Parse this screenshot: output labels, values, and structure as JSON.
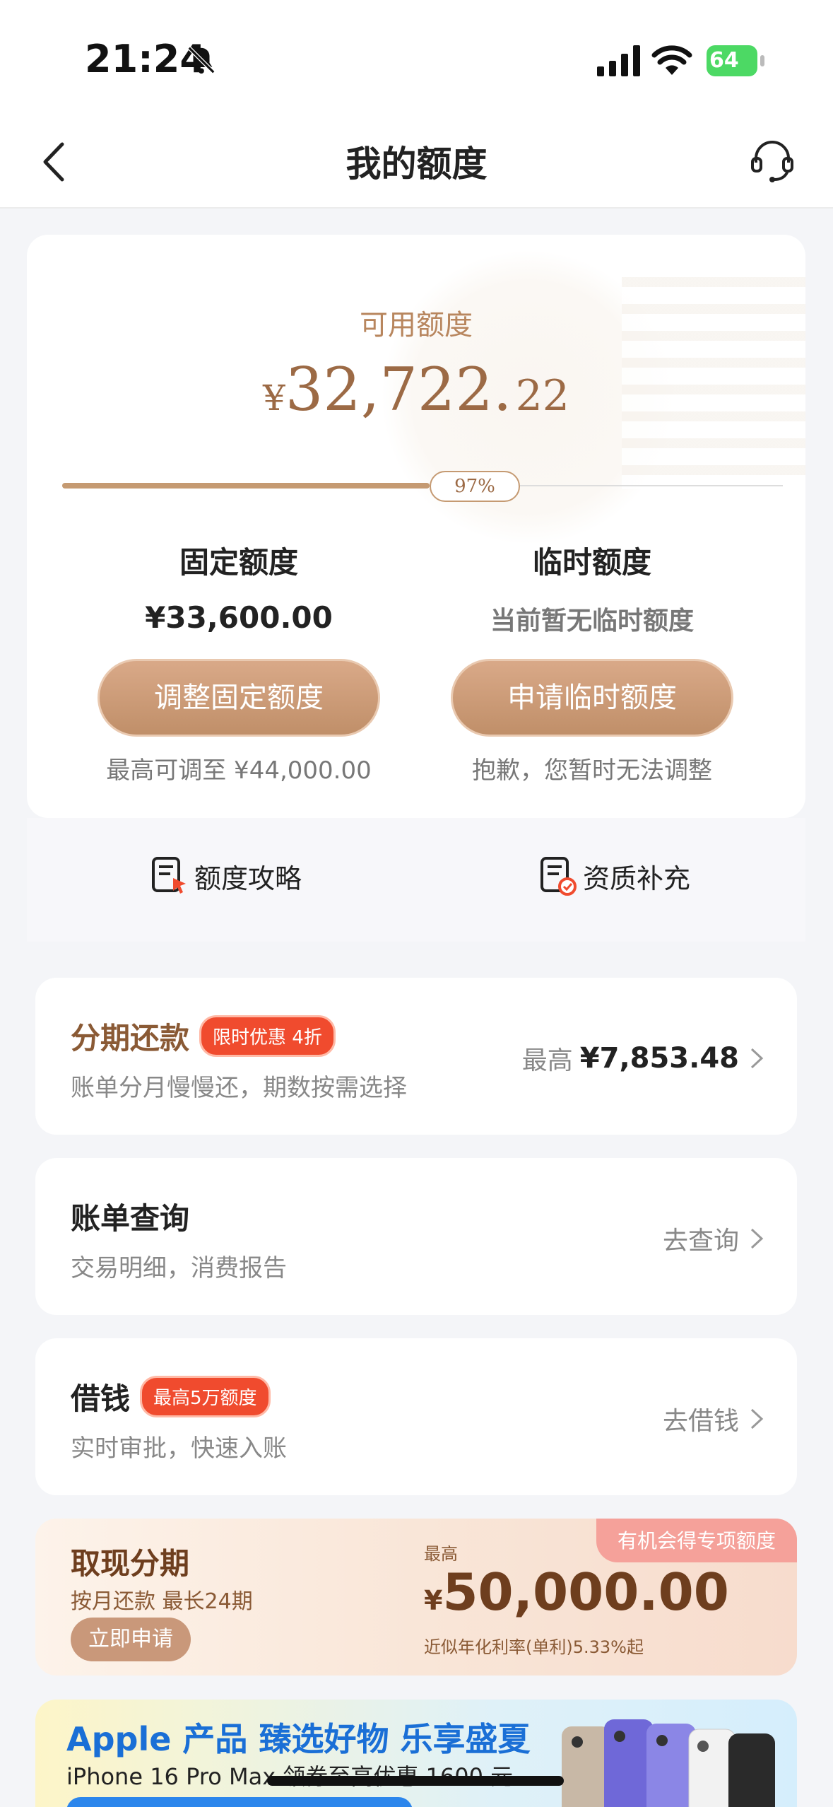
{
  "status_bar": {
    "time": "21:24",
    "battery": "64"
  },
  "nav": {
    "title": "我的额度"
  },
  "quota": {
    "label": "可用额度",
    "currency": "¥",
    "amount_int": "32,722.",
    "amount_dec": "22",
    "percent_label": "97%",
    "usage_fraction": 0.97,
    "fixed": {
      "title": "固定额度",
      "value": "¥33,600.00",
      "button": "调整固定额度",
      "note": "最高可调至 ¥44,000.00"
    },
    "temp": {
      "title": "临时额度",
      "value": "当前暂无临时额度",
      "button": "申请临时额度",
      "note": "抱歉，您暂时无法调整"
    }
  },
  "links": {
    "strategy": "额度攻略",
    "supplement": "资质补充"
  },
  "installment": {
    "title": "分期还款",
    "badge": "限时优惠 4折",
    "sub": "账单分月慢慢还，期数按需选择",
    "prefix": "最高",
    "amount": "¥7,853.48"
  },
  "bill": {
    "title": "账单查询",
    "sub": "交易明细，消费报告",
    "action": "去查询"
  },
  "borrow": {
    "title": "借钱",
    "badge": "最高5万额度",
    "sub": "实时审批，快速入账",
    "action": "去借钱"
  },
  "cash": {
    "title": "取现分期",
    "sub": "按月还款 最长24期",
    "button": "立即申请",
    "top_label": "最高",
    "currency": "¥",
    "amount": "50,000.00",
    "rate": "近似年化利率(单利)5.33%起",
    "tag": "有机会得专项额度"
  },
  "promo": {
    "title": "Apple 产品 臻选好物 乐享盛夏",
    "sub": "iPhone 16 Pro Max 领券至高优惠 1600 元"
  },
  "colors": {
    "accent": "#c59a72",
    "badge": "#f04b2e",
    "promo_blue": "#1a6fd6"
  }
}
